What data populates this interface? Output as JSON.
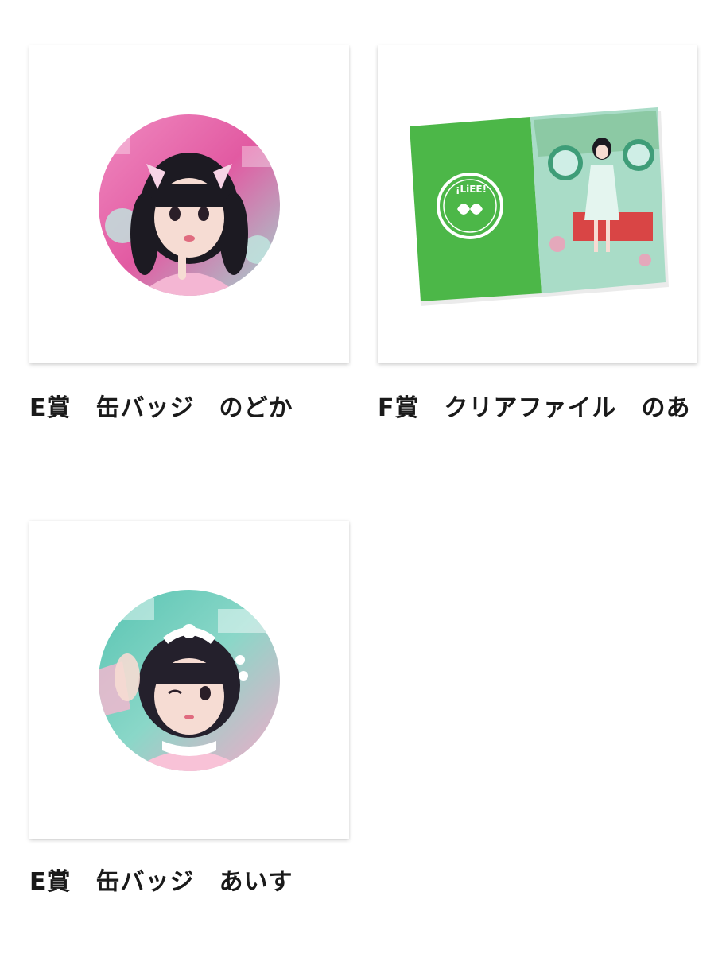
{
  "items": [
    {
      "title": "E賞　缶バッジ　のどか",
      "image_kind": "can-badge",
      "accent": "#e46aa8"
    },
    {
      "title": "F賞　クリアファイル　のあ",
      "image_kind": "clear-file",
      "accent": "#4cb748",
      "logo_text": "¡LiEE!"
    },
    {
      "title": "E賞　缶バッジ　あいす",
      "image_kind": "can-badge",
      "accent": "#5fc7b6"
    }
  ]
}
